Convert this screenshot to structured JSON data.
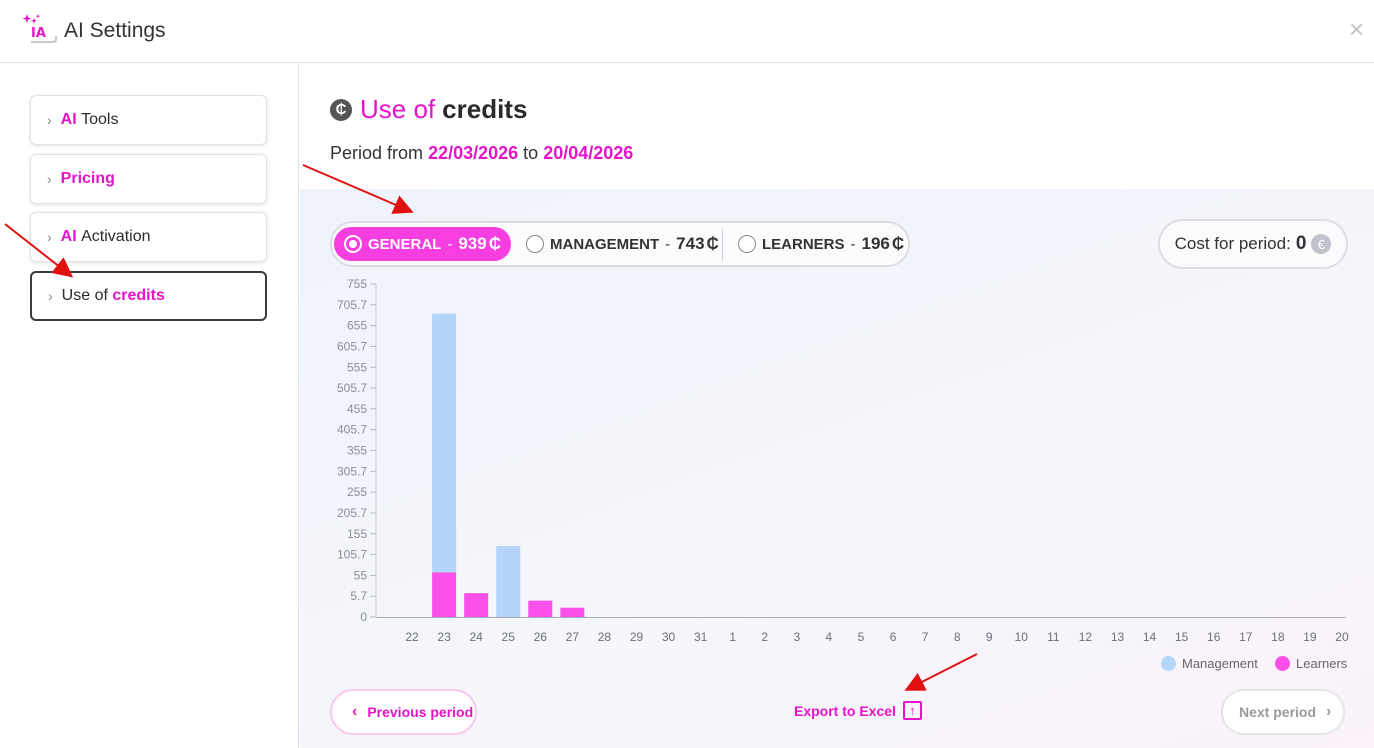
{
  "window": {
    "title": "AI Settings",
    "logo_text": "IA",
    "close_label": "×"
  },
  "sidebar": {
    "items": [
      {
        "part1": "AI",
        "part2": "Tools"
      },
      {
        "part1": "Pricing",
        "part2": ""
      },
      {
        "part1": "AI",
        "part2": "Activation"
      },
      {
        "part1": "Use of",
        "part2": "credits",
        "active": true
      }
    ]
  },
  "main": {
    "title_part1": "Use of",
    "title_part2": "credits",
    "credit_symbol": "₵",
    "period": {
      "prefix": "Period from",
      "from": "22/03/2026",
      "middle": "to",
      "to": "20/04/2026"
    },
    "filters": [
      {
        "label": "GENERAL",
        "value": "939",
        "unit": "₵",
        "selected": true
      },
      {
        "label": "MANAGEMENT",
        "value": "743",
        "unit": "₵",
        "selected": false
      },
      {
        "label": "LEARNERS",
        "value": "196",
        "unit": "₵",
        "selected": false
      }
    ],
    "cost": {
      "label": "Cost for period:",
      "value": "0",
      "currency": "€"
    },
    "buttons": {
      "previous": "Previous period",
      "next": "Next period",
      "export": "Export to Excel"
    }
  },
  "colors": {
    "accent": "#e514c9",
    "management": "#b3d5fa",
    "learners": "#fb4fe9"
  },
  "chart_data": {
    "type": "bar",
    "stacked": true,
    "categories": [
      "22",
      "23",
      "24",
      "25",
      "26",
      "27",
      "28",
      "29",
      "30",
      "31",
      "1",
      "2",
      "3",
      "4",
      "5",
      "6",
      "7",
      "8",
      "9",
      "10",
      "11",
      "12",
      "13",
      "14",
      "15",
      "16",
      "17",
      "18",
      "19",
      "20"
    ],
    "series": [
      {
        "name": "Learners",
        "values": [
          0,
          101,
          54,
          0,
          37,
          21,
          0,
          0,
          0,
          0,
          0,
          0,
          0,
          0,
          0,
          0,
          0,
          0,
          0,
          0,
          0,
          0,
          0,
          0,
          0,
          0,
          0,
          0,
          0,
          0
        ]
      },
      {
        "name": "Management",
        "values": [
          0,
          587,
          0,
          161,
          0,
          0,
          0,
          0,
          0,
          0,
          0,
          0,
          0,
          0,
          0,
          0,
          0,
          0,
          0,
          0,
          0,
          0,
          0,
          0,
          0,
          0,
          0,
          0,
          0,
          0
        ]
      }
    ],
    "yticks": [
      "0",
      "5.7",
      "55",
      "105.7",
      "155",
      "205.7",
      "255",
      "305.7",
      "355",
      "405.7",
      "455",
      "505.7",
      "555",
      "605.7",
      "655",
      "705.7",
      "755"
    ],
    "ylim": [
      0,
      755
    ],
    "legend": [
      "Management",
      "Learners"
    ],
    "legend_position": "bottom-right"
  }
}
